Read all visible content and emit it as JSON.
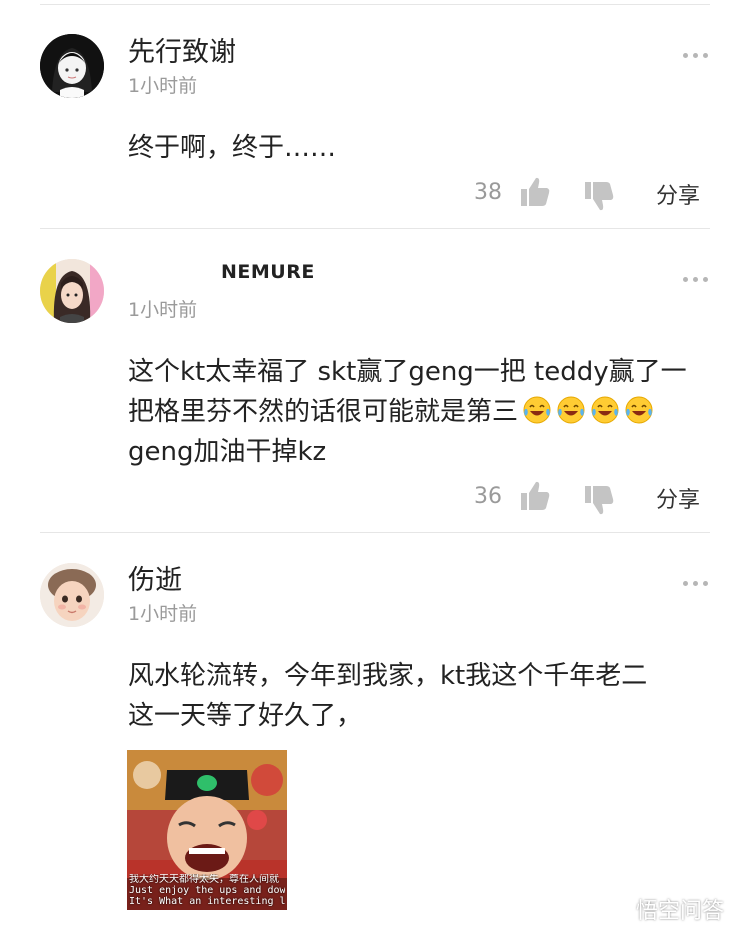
{
  "comments": [
    {
      "username": "先行致谢",
      "time": "1小时前",
      "text": "终于啊，终于……",
      "likes": "38",
      "share_label": "分享",
      "avatar": "cartoon-girl-avatar"
    },
    {
      "username": "NEMURE",
      "time": "1小时前",
      "text_line1": "这个kt太幸福了 skt赢了geng一把 teddy赢了一",
      "text_line2": "把格里芬不然的话很可能就是第三",
      "text_line3": "geng加油干掉kz",
      "emojis": [
        "laughing-tears",
        "laughing-tears",
        "laughing-tears",
        "laughing-tears"
      ],
      "likes": "36",
      "share_label": "分享",
      "avatar": "girl-photo-avatar"
    },
    {
      "username": "伤逝",
      "time": "1小时前",
      "text_line1": "风水轮流转，今年到我家，kt我这个千年老二",
      "text_line2": "这一天等了好久了，",
      "image": {
        "subtitle_cn": "我大约天天都得太失，尊在人间就",
        "subtitle_en1": "Just enjoy the ups and downs",
        "subtitle_en2": "It's What an interesting life"
      },
      "avatar": "baby-photo-avatar"
    }
  ],
  "watermark": {
    "text": "悟空问答",
    "icon": "wukong-logo-icon"
  }
}
